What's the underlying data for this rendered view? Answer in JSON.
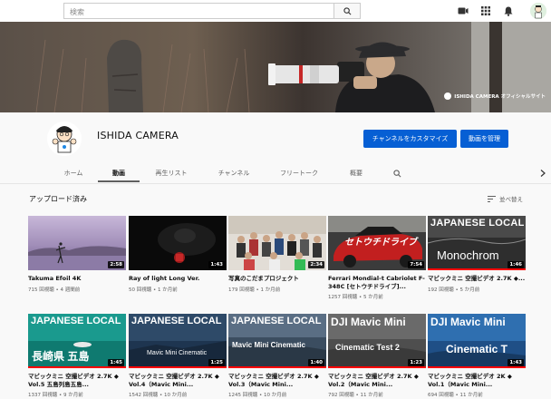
{
  "search": {
    "placeholder": "検索"
  },
  "banner": {
    "caption": "ISHIDA CAMERA オフィシャルサイト"
  },
  "channel": {
    "name": "ISHIDA CAMERA",
    "customize_label": "チャンネルをカスタマイズ",
    "manage_label": "動画を管理"
  },
  "tabs": [
    "ホーム",
    "動画",
    "再生リスト",
    "チャンネル",
    "フリートーク",
    "概要"
  ],
  "section": {
    "title": "アップロード済み",
    "sort_label": "並べ替え"
  },
  "videos": [
    {
      "title": "Takuma Efoil 4K",
      "views": "715 回視聴",
      "age": "4 週間前",
      "duration": "2:58",
      "thumb_text": ""
    },
    {
      "title": "Ray of light Long Ver.",
      "views": "50 回視聴",
      "age": "1 か月前",
      "duration": "1:43",
      "thumb_text": ""
    },
    {
      "title": "写真のこだまプロジェクト",
      "views": "179 回視聴",
      "age": "1 か月前",
      "duration": "2:34",
      "thumb_text": ""
    },
    {
      "title": "Ferrari Mondial-t Cabriolet F-348C [セトウチドライブ]...",
      "views": "1257 回視聴",
      "age": "5 か月前",
      "duration": "7:54",
      "thumb_text": "セトウチドライブ"
    },
    {
      "title": "マビックミニ 空撮ビデオ 2.7K ◆...",
      "views": "192 回視聴",
      "age": "5 か月前",
      "duration": "1:46",
      "thumb_text": "JAPANESE LOCAL",
      "thumb_text2": "Monochrom"
    },
    {
      "title": "マビックミニ 空撮ビデオ 2.7K ◆ Vol.5 五島列島五島...",
      "views": "1337 回視聴",
      "age": "9 か月前",
      "duration": "1:45",
      "thumb_text": "JAPANESE LOCAL",
      "thumb_text2": "長崎県 五島"
    },
    {
      "title": "マビックミニ 空撮ビデオ 2.7K ◆ Vol.4（Mavic Mini...",
      "views": "1542 回視聴",
      "age": "10 か月前",
      "duration": "1:25",
      "thumb_text": "JAPANESE LOCAL",
      "thumb_text2": "Mavic Mini Cinematic"
    },
    {
      "title": "マビックミニ 空撮ビデオ 2.7K ◆ Vol.3（Mavic Mini...",
      "views": "1245 回視聴",
      "age": "10 か月前",
      "duration": "1:40",
      "thumb_text": "JAPANESE LOCAL",
      "thumb_text2": "Mavic Mini Cinematic"
    },
    {
      "title": "マビックミニ 空撮ビデオ 2.7K ◆ Vol.2（Mavic Mini...",
      "views": "792 回視聴",
      "age": "11 か月前",
      "duration": "1:23",
      "thumb_text": "DJI Mavic Mini",
      "thumb_text2": "Cinematic Test 2"
    },
    {
      "title": "マビックミニ 空撮ビデオ 2K ◆ Vol.1（Mavic Mini...",
      "views": "694 回視聴",
      "age": "11 か月前",
      "duration": "1:43",
      "thumb_text": "DJI Mavic Mini",
      "thumb_text2": "Cinematic T"
    }
  ],
  "meta_separator": " • ",
  "colors": {
    "accent": "#065fd4",
    "progress": "#ff0000"
  }
}
